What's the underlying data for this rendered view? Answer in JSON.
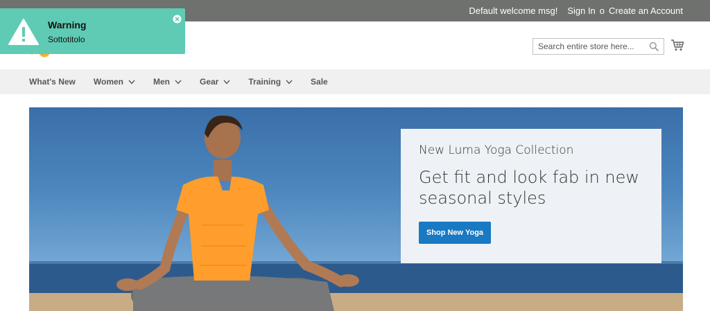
{
  "topbar": {
    "welcome": "Default welcome msg!",
    "sign_in": "Sign In",
    "separator": "o",
    "create_account": "Create an Account"
  },
  "header": {
    "search": {
      "placeholder": "Search entire store here..."
    },
    "icons": {
      "search": "search-icon",
      "cart": "cart-icon",
      "logo": "luma-logo"
    }
  },
  "nav": {
    "items": [
      {
        "label": "What's New",
        "has_dropdown": false
      },
      {
        "label": "Women",
        "has_dropdown": true
      },
      {
        "label": "Men",
        "has_dropdown": true
      },
      {
        "label": "Gear",
        "has_dropdown": true
      },
      {
        "label": "Training",
        "has_dropdown": true
      },
      {
        "label": "Sale",
        "has_dropdown": false
      }
    ]
  },
  "hero": {
    "subtitle": "New Luma Yoga Collection",
    "title": "Get fit and look fab in new seasonal styles",
    "button": "Shop New Yoga"
  },
  "toast": {
    "title": "Warning",
    "subtitle": "Sottotitolo",
    "icon": "warning-icon",
    "close_icon": "close-icon"
  },
  "colors": {
    "topbar_bg": "#6e716e",
    "nav_bg": "#f0f0f0",
    "button_blue": "#1979c3",
    "toast_bg": "#5fcbb4",
    "shirt_orange": "#ff9e2c",
    "sky_blue": "#4c86bd"
  }
}
